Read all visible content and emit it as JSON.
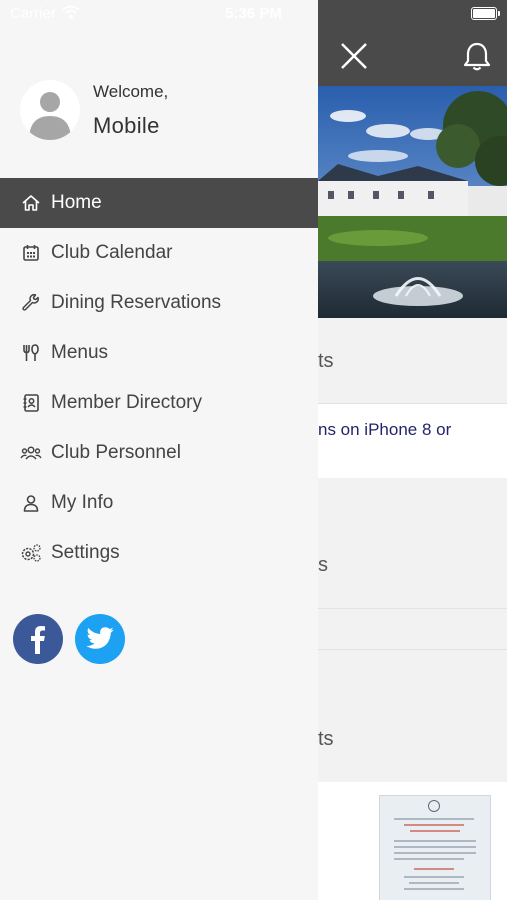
{
  "status_bar": {
    "carrier": "Carrier",
    "time": "5:36 PM"
  },
  "drawer": {
    "welcome": "Welcome,",
    "user_name": "Mobile",
    "menu": [
      {
        "label": "Home",
        "icon": "home-icon",
        "active": true
      },
      {
        "label": "Club Calendar",
        "icon": "calendar-icon"
      },
      {
        "label": "Dining Reservations",
        "icon": "wrench-icon"
      },
      {
        "label": "Menus",
        "icon": "utensils-icon"
      },
      {
        "label": "Member Directory",
        "icon": "contact-book-icon"
      },
      {
        "label": "Club Personnel",
        "icon": "users-icon"
      },
      {
        "label": "My Info",
        "icon": "user-icon"
      },
      {
        "label": "Settings",
        "icon": "gear-icon"
      }
    ],
    "social": [
      {
        "name": "facebook",
        "icon": "facebook-icon",
        "color": "#3b5998"
      },
      {
        "name": "twitter",
        "icon": "twitter-icon",
        "color": "#1da1f2"
      }
    ]
  },
  "background": {
    "section1_text": "ts",
    "link_text": "ns on iPhone 8 or",
    "section2_text": "s",
    "section3_text": "ts"
  },
  "colors": {
    "header": "#4a4a4a",
    "drawer_bg": "#f6f6f6",
    "active_item": "#4a4a4a",
    "link": "#24246b"
  }
}
